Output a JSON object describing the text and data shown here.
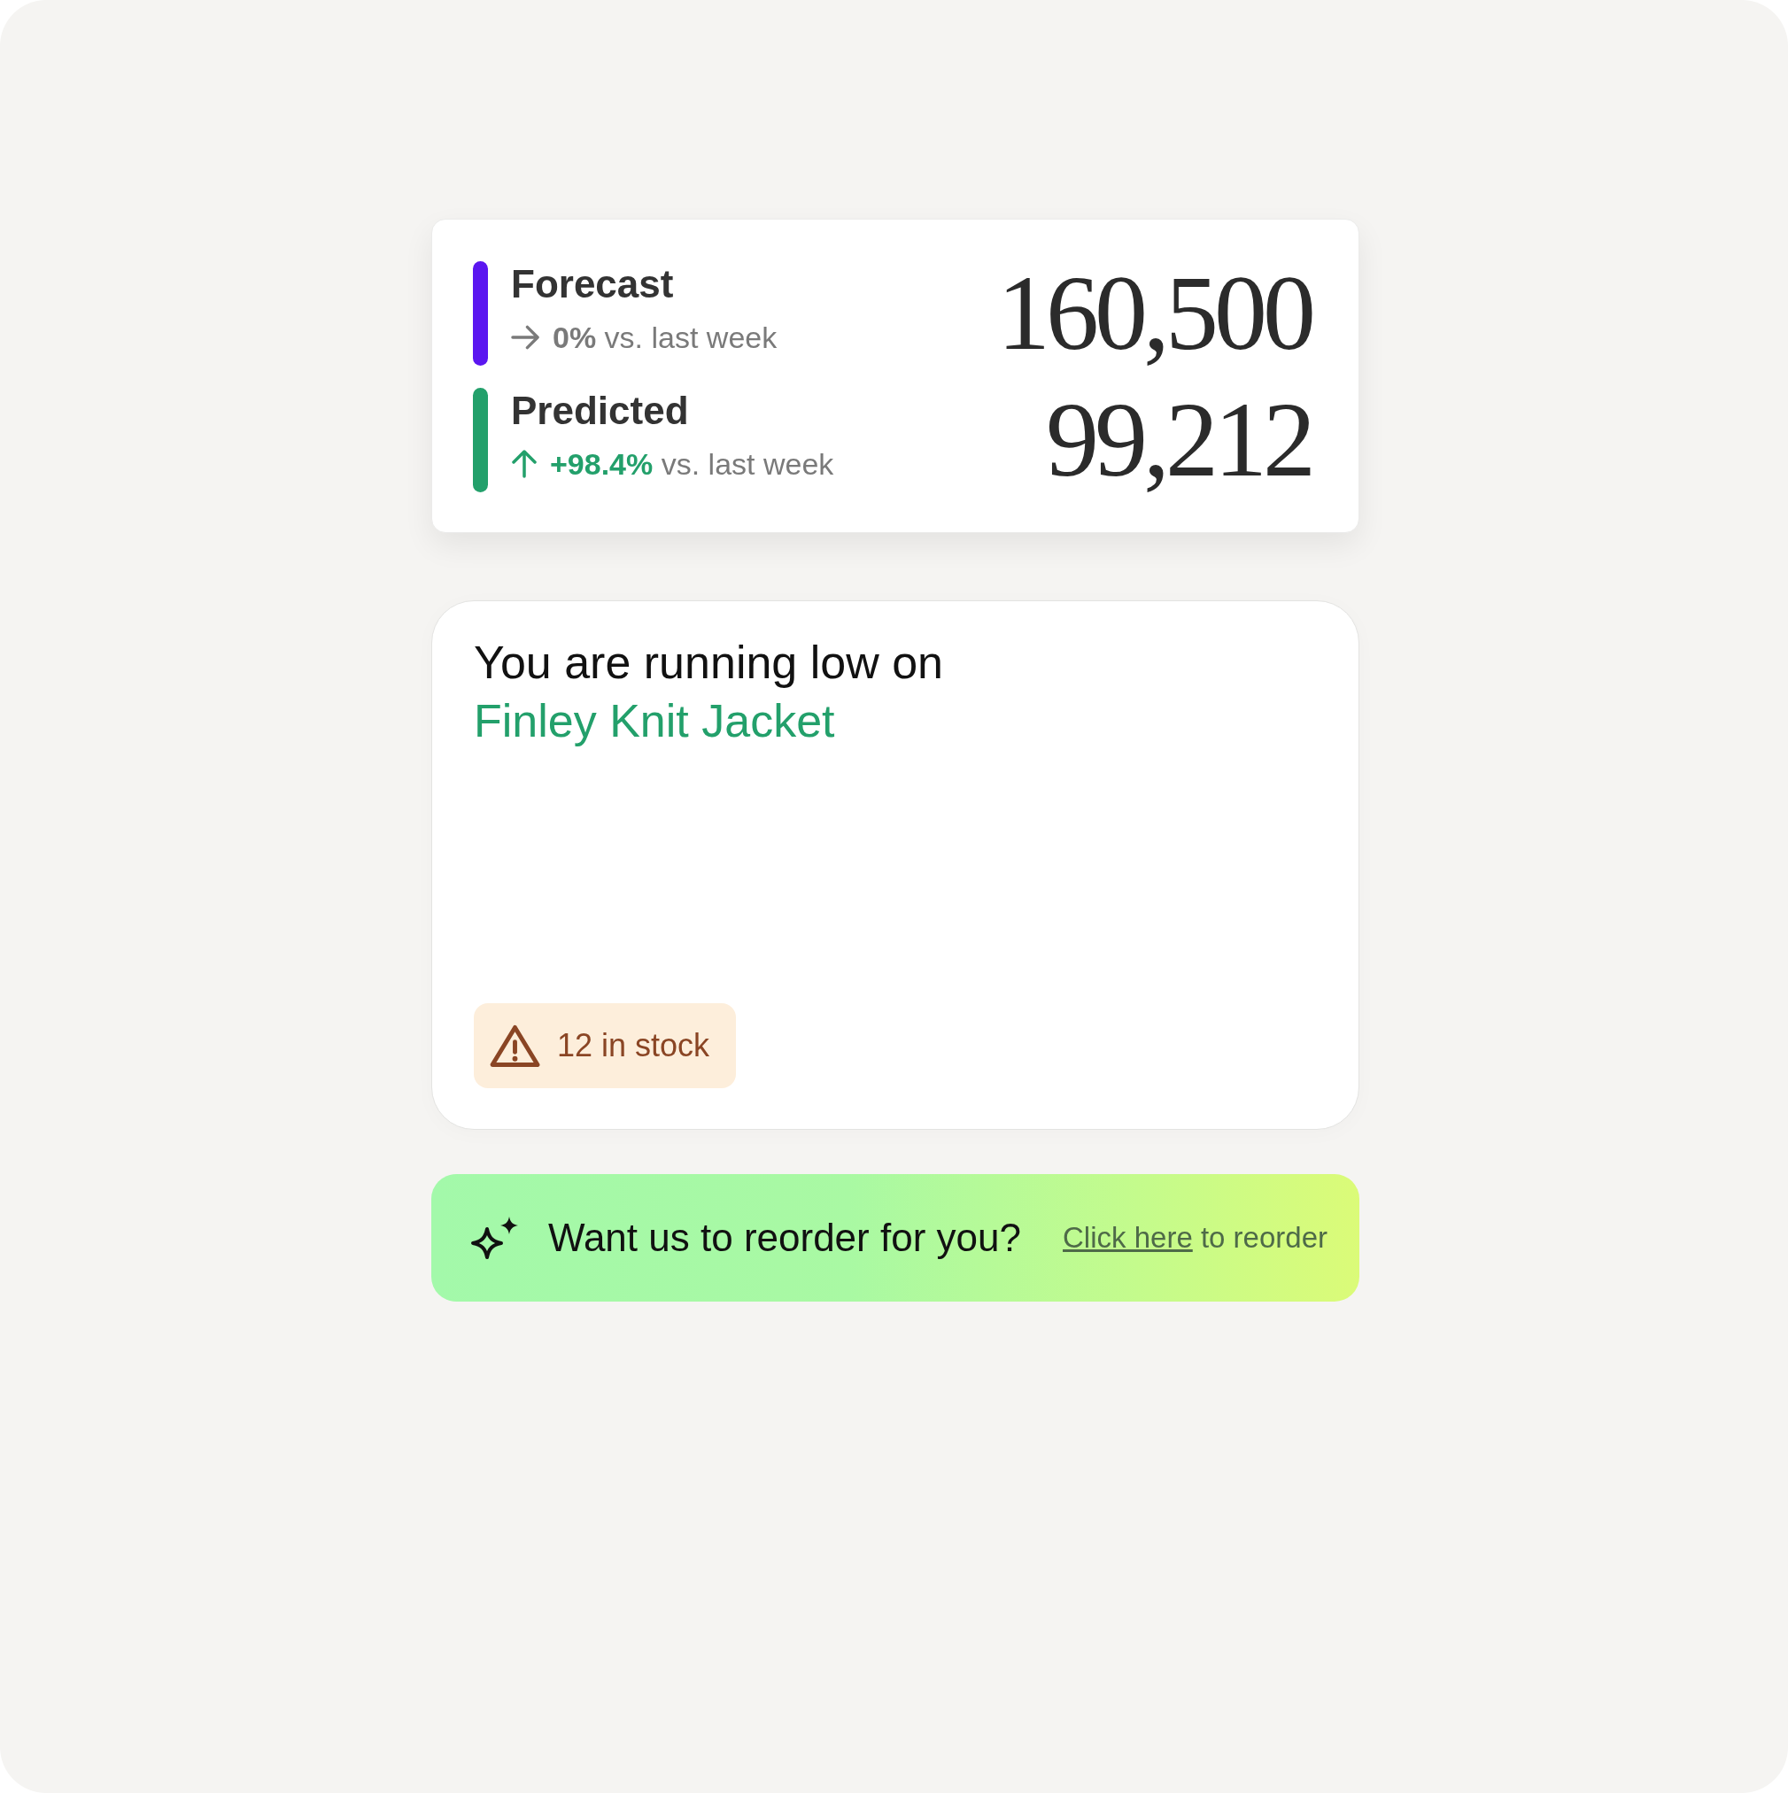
{
  "metrics_card": {
    "rows": [
      {
        "label": "Forecast",
        "color": "#5b16f0",
        "trend": {
          "kind": "flat",
          "change": "0%",
          "suffix": "vs. last week"
        },
        "value": "160,500"
      },
      {
        "label": "Predicted",
        "color": "#23a06b",
        "trend": {
          "kind": "up",
          "change": "+98.4%",
          "suffix": "vs. last week"
        },
        "value": "99,212"
      }
    ]
  },
  "stock_alert": {
    "heading": "You are running low on",
    "product": "Finley Knit Jacket",
    "badge": {
      "kind": "warning",
      "text": "12 in stock"
    }
  },
  "reorder_banner": {
    "prompt": "Want us to reorder for you?",
    "hint": {
      "link": "Click here",
      "text": "to reorder"
    }
  }
}
